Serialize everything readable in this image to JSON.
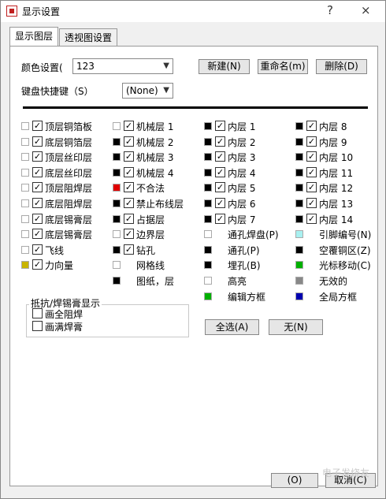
{
  "window": {
    "title": "显示设置",
    "help": "?",
    "close": "×"
  },
  "tabs": [
    "显示图层",
    "透视图设置"
  ],
  "color_setting": {
    "label": "颜色设置(",
    "value": "123"
  },
  "hotkey": {
    "label": "键盘快捷键（S）",
    "value": "(None)"
  },
  "buttons": {
    "new": "新建(N)",
    "rename": "重命名(m)",
    "delete": "删除(D)",
    "select_all": "全选(A)",
    "none": "无(N)"
  },
  "layers": {
    "col1": [
      {
        "name": "顶层铜箔板",
        "color": "#ffffff",
        "checked": true
      },
      {
        "name": "底层铜箔层",
        "color": "#ffffff",
        "checked": true
      },
      {
        "name": "顶层丝印层",
        "color": "#ffffff",
        "checked": true
      },
      {
        "name": "底层丝印层",
        "color": "#ffffff",
        "checked": true
      },
      {
        "name": "顶层阻焊层",
        "color": "#ffffff",
        "checked": true
      },
      {
        "name": "底层阻焊层",
        "color": "#ffffff",
        "checked": true
      },
      {
        "name": "底层锡膏层",
        "color": "#ffffff",
        "checked": true
      },
      {
        "name": "底层锡膏层",
        "color": "#ffffff",
        "checked": true
      },
      {
        "name": "飞线",
        "color": "#ffffff",
        "checked": true
      },
      {
        "name": "力向量",
        "color": "#c8b400",
        "checked": true
      }
    ],
    "col2": [
      {
        "name": "机械层 1",
        "color": "#ffffff",
        "checked": true
      },
      {
        "name": "机械层 2",
        "color": "#000000",
        "checked": true
      },
      {
        "name": "机械层 3",
        "color": "#000000",
        "checked": true
      },
      {
        "name": "机械层 4",
        "color": "#000000",
        "checked": true
      },
      {
        "name": "不合法",
        "color": "#e00000",
        "checked": true
      },
      {
        "name": "禁止布线层",
        "color": "#000000",
        "checked": true
      },
      {
        "name": "占据层",
        "color": "#000000",
        "checked": true
      },
      {
        "name": "边界层",
        "color": "#ffffff",
        "checked": true
      },
      {
        "name": "钻孔",
        "color": "#000000",
        "checked": true
      },
      {
        "name": "网格线",
        "color": "#ffffff",
        "checked": false
      },
      {
        "name": "图纸，层",
        "color": "#000000",
        "checked": false
      }
    ],
    "col3": [
      {
        "name": "内层 1",
        "color": "#000000",
        "checked": true
      },
      {
        "name": "内层 2",
        "color": "#000000",
        "checked": true
      },
      {
        "name": "内层 3",
        "color": "#000000",
        "checked": true
      },
      {
        "name": "内层 4",
        "color": "#000000",
        "checked": true
      },
      {
        "name": "内层 5",
        "color": "#000000",
        "checked": true
      },
      {
        "name": "内层 6",
        "color": "#000000",
        "checked": true
      },
      {
        "name": "内层 7",
        "color": "#000000",
        "checked": true
      },
      {
        "name": "通孔焊盘(P)",
        "color": "#ffffff",
        "checked": false
      },
      {
        "name": "通孔(P)",
        "color": "#000000",
        "checked": false
      },
      {
        "name": "埋孔(B)",
        "color": "#000000",
        "checked": false
      },
      {
        "name": "高亮",
        "color": "#ffffff",
        "checked": false
      },
      {
        "name": "编辑方框",
        "color": "#00b000",
        "checked": false
      }
    ],
    "col4": [
      {
        "name": "内层 8",
        "color": "#000000",
        "checked": true
      },
      {
        "name": "内层 9",
        "color": "#000000",
        "checked": true
      },
      {
        "name": "内层 10",
        "color": "#000000",
        "checked": true
      },
      {
        "name": "内层 11",
        "color": "#000000",
        "checked": true
      },
      {
        "name": "内层 12",
        "color": "#000000",
        "checked": true
      },
      {
        "name": "内层 13",
        "color": "#000000",
        "checked": true
      },
      {
        "name": "内层 14",
        "color": "#000000",
        "checked": true
      },
      {
        "name": "引脚编号(N)",
        "color": "#a8f0f0",
        "checked": false
      },
      {
        "name": "空覆铜区(Z)",
        "color": "#000000",
        "checked": false
      },
      {
        "name": "光标移动(C)",
        "color": "#00b000",
        "checked": false
      },
      {
        "name": "无效的",
        "color": "#888888",
        "checked": false
      },
      {
        "name": "全局方框",
        "color": "#0000b0",
        "checked": false
      }
    ]
  },
  "mask_group": {
    "title": "抵抗/焊锡膏显示",
    "items": [
      "画全阻焊",
      "画满焊膏"
    ]
  },
  "footer": {
    "ok": "(O)",
    "cancel": "取消(C)"
  },
  "watermark": "电子发烧友"
}
